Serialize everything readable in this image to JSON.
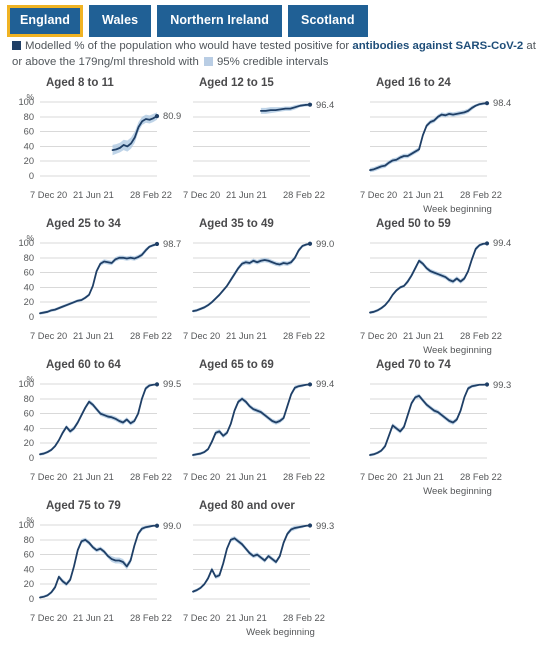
{
  "tabs": [
    {
      "label": "England",
      "selected": true
    },
    {
      "label": "Wales",
      "selected": false
    },
    {
      "label": "Northern Ireland",
      "selected": false
    },
    {
      "label": "Scotland",
      "selected": false
    }
  ],
  "legend": {
    "line_swatch_color": "#1f3f66",
    "band_swatch_color": "#b9cde4",
    "text_part1": "Modelled % of the population who would have tested positive for ",
    "text_bold": "antibodies against SARS-CoV-2",
    "text_part2": " at or above the 179ng/ml threshold with ",
    "text_part3": "95% credible intervals"
  },
  "axis": {
    "y_unit": "%",
    "y_ticks": [
      "100",
      "80",
      "60",
      "40",
      "20",
      "0"
    ],
    "x_ticks": [
      "7 Dec 20",
      "21 Jun 21",
      "28 Feb 22"
    ],
    "x_caption": "Week beginning"
  },
  "colors": {
    "tab_blue": "#206095",
    "tab_selected_border": "#f0b323",
    "line": "#1f3f66",
    "band": "#aac6e0",
    "grid": "#d9d9d9"
  },
  "chart_data": {
    "type": "line",
    "title": "Modelled % of the population who would have tested positive for antibodies against SARS-CoV-2 at or above the 179ng/ml threshold with 95% credible intervals",
    "xlabel": "Week beginning",
    "ylabel": "%",
    "ylim": [
      0,
      100
    ],
    "grid": true,
    "legend_position": "top",
    "x": [
      "7 Dec 20",
      "21 Jun 21",
      "28 Feb 22"
    ],
    "panels": [
      {
        "name": "Aged 8 to 11",
        "end_value": "80.9",
        "start_index": 0.62,
        "values": [
          35,
          36,
          38,
          42,
          40,
          44,
          52,
          66,
          74,
          77,
          76,
          78,
          80.9
        ],
        "band_lower": [
          28,
          30,
          32,
          35,
          33,
          37,
          45,
          60,
          69,
          72,
          71,
          73,
          76
        ],
        "band_upper": [
          42,
          43,
          45,
          49,
          48,
          52,
          60,
          73,
          80,
          83,
          82,
          84,
          86
        ]
      },
      {
        "name": "Aged 12 to 15",
        "end_value": "96.4",
        "start_index": 0.58,
        "values": [
          88,
          88,
          89,
          89,
          90,
          91,
          91,
          93,
          95,
          96,
          96.4
        ],
        "band_lower": [
          84,
          84,
          85,
          86,
          87,
          88,
          88,
          90,
          93,
          94,
          94.5
        ],
        "band_upper": [
          92,
          92,
          93,
          93,
          93,
          94,
          94,
          96,
          97,
          98,
          98
        ]
      },
      {
        "name": "Aged 16 to 24",
        "end_value": "98.4",
        "start_index": 0,
        "values": [
          8,
          9,
          11,
          13,
          14,
          18,
          21,
          22,
          25,
          27,
          27,
          30,
          33,
          36,
          55,
          68,
          73,
          75,
          80,
          83,
          82,
          84,
          83,
          84,
          85,
          86,
          88,
          92,
          95,
          97,
          98,
          98.4
        ],
        "band_lower": [
          5,
          6,
          8,
          10,
          11,
          15,
          18,
          19,
          22,
          24,
          24,
          27,
          30,
          33,
          52,
          65,
          70,
          72,
          77,
          80,
          79,
          81,
          80,
          81,
          82,
          83,
          85,
          89,
          93,
          95,
          96,
          97
        ],
        "band_upper": [
          11,
          12,
          14,
          16,
          17,
          21,
          24,
          25,
          28,
          30,
          30,
          33,
          36,
          39,
          58,
          71,
          76,
          78,
          83,
          86,
          85,
          87,
          86,
          87,
          88,
          89,
          91,
          95,
          97,
          99,
          99,
          99
        ]
      },
      {
        "name": "Aged 25 to 34",
        "end_value": "98.7",
        "start_index": 0,
        "values": [
          5,
          6,
          7,
          9,
          10,
          12,
          14,
          16,
          18,
          20,
          22,
          23,
          26,
          30,
          42,
          62,
          72,
          75,
          74,
          73,
          78,
          80,
          80,
          79,
          80,
          79,
          81,
          84,
          90,
          95,
          97,
          98.7
        ],
        "band_lower": [
          3,
          4,
          5,
          7,
          8,
          10,
          12,
          14,
          16,
          18,
          20,
          21,
          24,
          28,
          39,
          59,
          69,
          72,
          71,
          70,
          75,
          77,
          77,
          76,
          77,
          76,
          78,
          81,
          87,
          93,
          95,
          97
        ],
        "band_upper": [
          7,
          8,
          9,
          11,
          12,
          14,
          16,
          18,
          20,
          22,
          24,
          25,
          28,
          32,
          45,
          65,
          75,
          78,
          77,
          76,
          81,
          83,
          83,
          82,
          83,
          82,
          84,
          87,
          93,
          97,
          99,
          99
        ]
      },
      {
        "name": "Aged 35 to 49",
        "end_value": "99.0",
        "start_index": 0,
        "values": [
          8,
          9,
          11,
          13,
          16,
          20,
          25,
          30,
          36,
          42,
          50,
          58,
          66,
          72,
          74,
          73,
          76,
          74,
          76,
          77,
          76,
          74,
          72,
          71,
          73,
          72,
          74,
          80,
          90,
          96,
          98,
          99.0
        ],
        "band_lower": [
          6,
          7,
          9,
          11,
          14,
          18,
          23,
          28,
          34,
          40,
          47,
          55,
          63,
          69,
          71,
          70,
          73,
          71,
          73,
          74,
          73,
          71,
          69,
          68,
          70,
          69,
          71,
          77,
          87,
          94,
          96,
          98
        ],
        "band_upper": [
          10,
          11,
          13,
          15,
          18,
          22,
          27,
          32,
          38,
          44,
          53,
          61,
          69,
          75,
          77,
          76,
          79,
          77,
          79,
          80,
          79,
          77,
          75,
          74,
          76,
          75,
          77,
          83,
          93,
          98,
          99,
          99
        ]
      },
      {
        "name": "Aged 50 to 59",
        "end_value": "99.4",
        "start_index": 0,
        "values": [
          6,
          7,
          9,
          12,
          16,
          22,
          30,
          36,
          40,
          42,
          48,
          56,
          66,
          76,
          72,
          66,
          62,
          60,
          58,
          56,
          54,
          50,
          48,
          52,
          48,
          52,
          62,
          78,
          92,
          97,
          99,
          99.4
        ],
        "band_lower": [
          4,
          5,
          7,
          10,
          14,
          20,
          28,
          34,
          38,
          40,
          45,
          53,
          63,
          73,
          69,
          63,
          59,
          57,
          55,
          53,
          51,
          47,
          45,
          49,
          45,
          49,
          59,
          75,
          89,
          95,
          97,
          98
        ],
        "band_upper": [
          8,
          9,
          11,
          14,
          18,
          24,
          32,
          38,
          42,
          44,
          51,
          59,
          69,
          79,
          75,
          69,
          65,
          63,
          61,
          59,
          57,
          53,
          51,
          55,
          51,
          55,
          65,
          81,
          95,
          99,
          100,
          100
        ]
      },
      {
        "name": "Aged 60 to 64",
        "end_value": "99.5",
        "start_index": 0,
        "values": [
          5,
          6,
          8,
          11,
          16,
          24,
          34,
          42,
          36,
          40,
          48,
          58,
          68,
          76,
          72,
          66,
          60,
          58,
          56,
          55,
          53,
          50,
          48,
          52,
          47,
          50,
          60,
          80,
          94,
          98,
          99,
          99.5
        ],
        "band_lower": [
          3,
          4,
          6,
          9,
          14,
          22,
          31,
          39,
          33,
          37,
          45,
          55,
          65,
          73,
          69,
          63,
          57,
          55,
          53,
          52,
          50,
          47,
          45,
          49,
          44,
          47,
          57,
          77,
          91,
          96,
          98,
          99
        ],
        "band_upper": [
          7,
          8,
          10,
          13,
          18,
          26,
          37,
          45,
          39,
          43,
          51,
          61,
          71,
          79,
          75,
          69,
          63,
          61,
          59,
          58,
          56,
          53,
          51,
          55,
          50,
          53,
          63,
          83,
          97,
          100,
          100,
          100
        ]
      },
      {
        "name": "Aged 65 to 69",
        "end_value": "99.4",
        "start_index": 0,
        "values": [
          4,
          5,
          6,
          8,
          12,
          22,
          34,
          36,
          30,
          34,
          46,
          64,
          76,
          80,
          76,
          70,
          66,
          64,
          62,
          58,
          54,
          50,
          48,
          50,
          54,
          70,
          86,
          95,
          97,
          98,
          99,
          99.4
        ],
        "band_lower": [
          2,
          3,
          4,
          6,
          10,
          19,
          31,
          33,
          27,
          31,
          43,
          61,
          73,
          77,
          73,
          67,
          63,
          61,
          59,
          55,
          51,
          47,
          45,
          47,
          51,
          67,
          83,
          92,
          95,
          96,
          98,
          98
        ],
        "band_upper": [
          6,
          7,
          8,
          10,
          14,
          25,
          37,
          39,
          33,
          37,
          49,
          67,
          79,
          83,
          79,
          73,
          69,
          67,
          65,
          61,
          57,
          53,
          51,
          53,
          57,
          73,
          89,
          98,
          99,
          100,
          100,
          100
        ]
      },
      {
        "name": "Aged 70 to 74",
        "end_value": "99.3",
        "start_index": 0,
        "values": [
          4,
          5,
          7,
          10,
          16,
          30,
          44,
          40,
          36,
          42,
          58,
          74,
          82,
          84,
          78,
          72,
          68,
          64,
          62,
          58,
          54,
          50,
          48,
          52,
          64,
          82,
          94,
          97,
          98,
          99,
          99,
          99.3
        ],
        "band_lower": [
          2,
          3,
          5,
          8,
          13,
          27,
          41,
          37,
          33,
          39,
          55,
          71,
          79,
          81,
          75,
          69,
          65,
          61,
          59,
          55,
          51,
          47,
          45,
          49,
          61,
          79,
          91,
          95,
          96,
          98,
          98,
          98
        ],
        "band_upper": [
          6,
          7,
          9,
          12,
          19,
          33,
          47,
          43,
          39,
          45,
          61,
          77,
          85,
          87,
          81,
          75,
          71,
          67,
          65,
          61,
          57,
          53,
          51,
          55,
          67,
          85,
          97,
          99,
          100,
          100,
          100,
          100
        ]
      },
      {
        "name": "Aged 75 to 79",
        "end_value": "99.0",
        "start_index": 0,
        "values": [
          2,
          3,
          5,
          9,
          16,
          30,
          24,
          20,
          26,
          44,
          66,
          78,
          80,
          76,
          70,
          66,
          68,
          64,
          58,
          54,
          52,
          52,
          50,
          44,
          52,
          72,
          88,
          95,
          97,
          98,
          99,
          99.0
        ],
        "band_lower": [
          1,
          2,
          3,
          7,
          13,
          27,
          21,
          17,
          23,
          41,
          63,
          75,
          77,
          73,
          67,
          63,
          65,
          61,
          55,
          50,
          48,
          48,
          46,
          40,
          48,
          69,
          85,
          92,
          95,
          96,
          98,
          98
        ],
        "band_upper": [
          4,
          5,
          7,
          11,
          19,
          33,
          27,
          23,
          29,
          47,
          69,
          81,
          83,
          79,
          73,
          69,
          71,
          67,
          61,
          58,
          56,
          56,
          54,
          48,
          56,
          75,
          91,
          98,
          99,
          100,
          100,
          100
        ]
      },
      {
        "name": "Aged 80 and over",
        "end_value": "99.3",
        "start_index": 0,
        "values": [
          10,
          12,
          15,
          20,
          28,
          40,
          30,
          32,
          48,
          68,
          80,
          82,
          78,
          74,
          68,
          62,
          58,
          60,
          56,
          52,
          58,
          54,
          50,
          58,
          76,
          88,
          94,
          96,
          97,
          98,
          99,
          99.3
        ],
        "band_lower": [
          8,
          10,
          13,
          18,
          25,
          37,
          27,
          29,
          45,
          65,
          77,
          79,
          75,
          71,
          65,
          59,
          55,
          57,
          53,
          49,
          55,
          51,
          47,
          55,
          73,
          85,
          91,
          93,
          95,
          96,
          98,
          98
        ],
        "band_upper": [
          12,
          14,
          17,
          22,
          31,
          43,
          33,
          35,
          51,
          71,
          83,
          85,
          81,
          77,
          71,
          65,
          61,
          63,
          59,
          55,
          61,
          57,
          53,
          61,
          79,
          91,
          97,
          99,
          99,
          100,
          100,
          100
        ]
      }
    ]
  }
}
